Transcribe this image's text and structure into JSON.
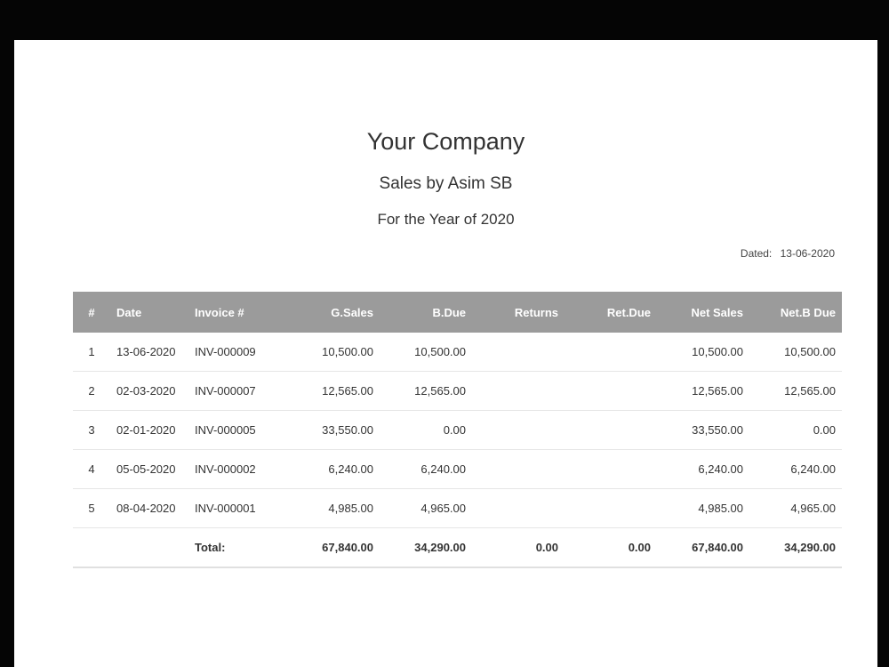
{
  "report": {
    "company": "Your Company",
    "subtitle": "Sales by Asim SB",
    "period": "For the Year of 2020",
    "dated_label": "Dated:",
    "dated_value": "13-06-2020"
  },
  "table": {
    "headers": {
      "num": "#",
      "date": "Date",
      "invoice": "Invoice #",
      "gsales": "G.Sales",
      "bdue": "B.Due",
      "returns": "Returns",
      "retdue": "Ret.Due",
      "netsales": "Net Sales",
      "netbdue": "Net.B Due"
    },
    "rows": [
      {
        "num": "1",
        "date": "13-06-2020",
        "invoice": "INV-000009",
        "gsales": "10,500.00",
        "bdue": "10,500.00",
        "returns": "",
        "retdue": "",
        "netsales": "10,500.00",
        "netbdue": "10,500.00"
      },
      {
        "num": "2",
        "date": "02-03-2020",
        "invoice": "INV-000007",
        "gsales": "12,565.00",
        "bdue": "12,565.00",
        "returns": "",
        "retdue": "",
        "netsales": "12,565.00",
        "netbdue": "12,565.00"
      },
      {
        "num": "3",
        "date": "02-01-2020",
        "invoice": "INV-000005",
        "gsales": "33,550.00",
        "bdue": "0.00",
        "returns": "",
        "retdue": "",
        "netsales": "33,550.00",
        "netbdue": "0.00"
      },
      {
        "num": "4",
        "date": "05-05-2020",
        "invoice": "INV-000002",
        "gsales": "6,240.00",
        "bdue": "6,240.00",
        "returns": "",
        "retdue": "",
        "netsales": "6,240.00",
        "netbdue": "6,240.00"
      },
      {
        "num": "5",
        "date": "08-04-2020",
        "invoice": "INV-000001",
        "gsales": "4,985.00",
        "bdue": "4,965.00",
        "returns": "",
        "retdue": "",
        "netsales": "4,985.00",
        "netbdue": "4,965.00"
      }
    ],
    "total": {
      "label": "Total:",
      "gsales": "67,840.00",
      "bdue": "34,290.00",
      "returns": "0.00",
      "retdue": "0.00",
      "netsales": "67,840.00",
      "netbdue": "34,290.00"
    }
  }
}
